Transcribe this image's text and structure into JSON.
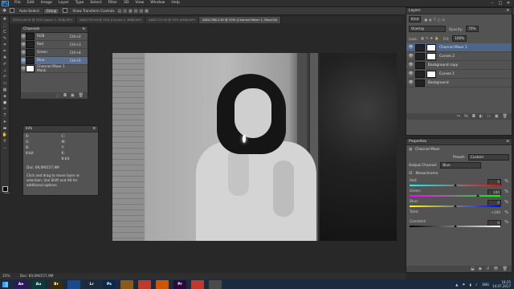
{
  "app": {
    "logo": "Ps"
  },
  "menu": [
    "File",
    "Edit",
    "Image",
    "Layer",
    "Type",
    "Select",
    "Filter",
    "3D",
    "View",
    "Window",
    "Help"
  ],
  "options_bar": {
    "auto_select_label": "Auto-Select:",
    "auto_select_value": "Group",
    "show_transform_label": "Show Transform Controls"
  },
  "doc_tabs": [
    {
      "label": "DTS1149.tif @ 25% (Layer 1, RGB/16*)",
      "active": false
    },
    {
      "label": "XAD1753.tif @ 25% (Curves 1, RGB/16*)",
      "active": false
    },
    {
      "label": "XAD1727.tif @ 25% (RGB/16*)",
      "active": false
    },
    {
      "label": "XAD1766-2.tif @ 25% (Channel Mixer 1, Blue/16)",
      "active": true
    }
  ],
  "channels_panel": {
    "title": "Channels",
    "rows": [
      {
        "name": "RGB",
        "key": "Ctrl+2",
        "selected": false,
        "light": false
      },
      {
        "name": "Red",
        "key": "Ctrl+3",
        "selected": false,
        "light": false
      },
      {
        "name": "Green",
        "key": "Ctrl+4",
        "selected": false,
        "light": false
      },
      {
        "name": "Blue",
        "key": "Ctrl+5",
        "selected": true,
        "light": false
      },
      {
        "name": "Channel Mixer 1 Mask",
        "key": "",
        "selected": false,
        "light": true
      }
    ]
  },
  "info_panel": {
    "title": "Info",
    "cells": [
      "R:",
      "C:",
      "G:",
      "M:",
      "B:",
      "Y:",
      "8-bit",
      "K:",
      "",
      "8-bit"
    ],
    "doc_line": "Doc: 69,0M/157,9M",
    "hint": "Click and drag to move layer or selection. Use Shift and Alt for additional options."
  },
  "layers_panel": {
    "title": "Layers",
    "kind_label": "Kind",
    "blend_mode": "Overlay",
    "opacity_label": "Opacity:",
    "opacity_value": "70%",
    "lock_label": "Lock:",
    "fill_label": "Fill:",
    "fill_value": "100%",
    "layers": [
      {
        "name": "Channel Mixer 1",
        "selected": true,
        "mask": true
      },
      {
        "name": "Curves 2",
        "selected": false,
        "mask": true
      },
      {
        "name": "Background copy",
        "selected": false,
        "mask": false
      },
      {
        "name": "Curves 1",
        "selected": false,
        "mask": true
      },
      {
        "name": "Background",
        "selected": false,
        "mask": false
      }
    ]
  },
  "properties_panel": {
    "title": "Properties",
    "subtitle": "Channel Mixer",
    "preset_label": "Preset:",
    "preset_value": "Custom",
    "output_label": "Output Channel:",
    "output_value": "Blue",
    "monochrome_label": "Monochrome",
    "sliders": [
      {
        "label": "Red:",
        "value": "0",
        "pct": "%",
        "fraction": 0.5,
        "track": "linear-gradient(90deg,#00ffff,#ff0000)"
      },
      {
        "label": "Green:",
        "value": "100",
        "pct": "%",
        "fraction": 0.75,
        "track": "linear-gradient(90deg,#ff00ff,#00ff00)"
      },
      {
        "label": "Blue:",
        "value": "0",
        "pct": "%",
        "fraction": 0.5,
        "track": "linear-gradient(90deg,#ffff00,#0000ff)"
      }
    ],
    "total_label": "Total:",
    "total_value": "+100",
    "total_pct": "%",
    "constant_label": "Constant:",
    "constant_value": "0",
    "constant_pct": "%",
    "constant_fraction": 0.5
  },
  "status": {
    "zoom": "25%",
    "doc": "Doc: 69,0M/157,9M"
  },
  "taskbar": {
    "apps": [
      {
        "label": "Ae",
        "color": "#2a1a5a"
      },
      {
        "label": "Au",
        "color": "#0a3a3a"
      },
      {
        "label": "Br",
        "color": "#3a2a0a"
      },
      {
        "label": "",
        "color": "#1a4a8a"
      },
      {
        "label": "Lr",
        "color": "#1a2a3a"
      },
      {
        "label": "Ps",
        "color": "#0a2a4a"
      },
      {
        "label": "",
        "color": "#8a5a1a"
      },
      {
        "label": "",
        "color": "#c0392b"
      },
      {
        "label": "",
        "color": "#d35400"
      },
      {
        "label": "Pr",
        "color": "#2a0a3a"
      },
      {
        "label": "",
        "color": "#c0392b"
      },
      {
        "label": "",
        "color": "#4a4a4a"
      }
    ],
    "lang": "ENG",
    "time": "18:25",
    "date": "14.07.2017"
  }
}
